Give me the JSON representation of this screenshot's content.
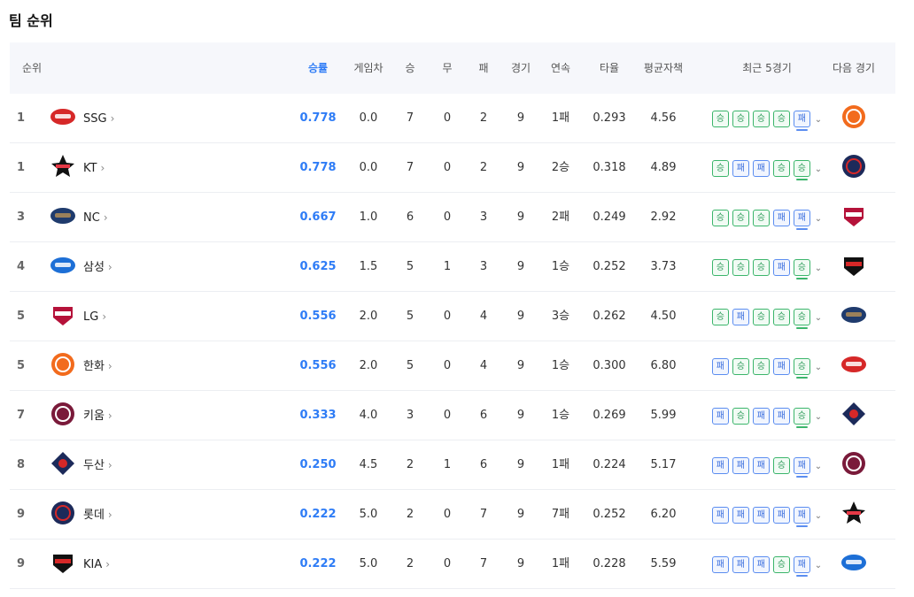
{
  "page": {
    "title": "팀 순위"
  },
  "header": {
    "rank": "순위",
    "pct": "승률",
    "gb": "게임차",
    "w": "승",
    "d": "무",
    "l": "패",
    "g": "경기",
    "streak": "연속",
    "avg": "타율",
    "era": "평균자책",
    "recent": "최근 5경기",
    "next": "다음 경기"
  },
  "result_labels": {
    "W": "승",
    "L": "패"
  },
  "colors": {
    "accent": "#2e7cf6",
    "win": "#3bb56b",
    "loss": "#5b8df0"
  },
  "teams": [
    {
      "rank": "1",
      "name": "SSG",
      "logo": "ssg-landers-logo",
      "pct": "0.778",
      "gb": "0.0",
      "w": "7",
      "d": "0",
      "l": "2",
      "g": "9",
      "streak": "1패",
      "avg": "0.293",
      "era": "4.56",
      "recent": [
        "W",
        "W",
        "W",
        "W",
        "L"
      ],
      "next": "eagles-logo"
    },
    {
      "rank": "1",
      "name": "KT",
      "logo": "kt-wiz-logo",
      "pct": "0.778",
      "gb": "0.0",
      "w": "7",
      "d": "0",
      "l": "2",
      "g": "9",
      "streak": "2승",
      "avg": "0.318",
      "era": "4.89",
      "recent": [
        "W",
        "L",
        "L",
        "W",
        "W"
      ],
      "next": "giants-logo"
    },
    {
      "rank": "3",
      "name": "NC",
      "logo": "nc-dinos-logo",
      "pct": "0.667",
      "gb": "1.0",
      "w": "6",
      "d": "0",
      "l": "3",
      "g": "9",
      "streak": "2패",
      "avg": "0.249",
      "era": "2.92",
      "recent": [
        "W",
        "W",
        "W",
        "L",
        "L"
      ],
      "next": "twins-logo"
    },
    {
      "rank": "4",
      "name": "삼성",
      "logo": "samsung-lions-logo",
      "pct": "0.625",
      "gb": "1.5",
      "w": "5",
      "d": "1",
      "l": "3",
      "g": "9",
      "streak": "1승",
      "avg": "0.252",
      "era": "3.73",
      "recent": [
        "W",
        "W",
        "W",
        "L",
        "W"
      ],
      "next": "tigers-logo"
    },
    {
      "rank": "5",
      "name": "LG",
      "logo": "lg-twins-logo",
      "pct": "0.556",
      "gb": "2.0",
      "w": "5",
      "d": "0",
      "l": "4",
      "g": "9",
      "streak": "3승",
      "avg": "0.262",
      "era": "4.50",
      "recent": [
        "W",
        "L",
        "W",
        "W",
        "W"
      ],
      "next": "dinos-logo"
    },
    {
      "rank": "5",
      "name": "한화",
      "logo": "hanwha-eagles-logo",
      "pct": "0.556",
      "gb": "2.0",
      "w": "5",
      "d": "0",
      "l": "4",
      "g": "9",
      "streak": "1승",
      "avg": "0.300",
      "era": "6.80",
      "recent": [
        "L",
        "W",
        "W",
        "L",
        "W"
      ],
      "next": "landers-logo"
    },
    {
      "rank": "7",
      "name": "키움",
      "logo": "kiwoom-heroes-logo",
      "pct": "0.333",
      "gb": "4.0",
      "w": "3",
      "d": "0",
      "l": "6",
      "g": "9",
      "streak": "1승",
      "avg": "0.269",
      "era": "5.99",
      "recent": [
        "L",
        "W",
        "L",
        "L",
        "W"
      ],
      "next": "bears-logo"
    },
    {
      "rank": "8",
      "name": "두산",
      "logo": "doosan-bears-logo",
      "pct": "0.250",
      "gb": "4.5",
      "w": "2",
      "d": "1",
      "l": "6",
      "g": "9",
      "streak": "1패",
      "avg": "0.224",
      "era": "5.17",
      "recent": [
        "L",
        "L",
        "L",
        "W",
        "L"
      ],
      "next": "heroes-logo"
    },
    {
      "rank": "9",
      "name": "롯데",
      "logo": "lotte-giants-logo",
      "pct": "0.222",
      "gb": "5.0",
      "w": "2",
      "d": "0",
      "l": "7",
      "g": "9",
      "streak": "7패",
      "avg": "0.252",
      "era": "6.20",
      "recent": [
        "L",
        "L",
        "L",
        "L",
        "L"
      ],
      "next": "wiz-logo"
    },
    {
      "rank": "9",
      "name": "KIA",
      "logo": "kia-tigers-logo",
      "pct": "0.222",
      "gb": "5.0",
      "w": "2",
      "d": "0",
      "l": "7",
      "g": "9",
      "streak": "1패",
      "avg": "0.228",
      "era": "5.59",
      "recent": [
        "L",
        "L",
        "L",
        "W",
        "L"
      ],
      "next": "lions-logo"
    }
  ]
}
